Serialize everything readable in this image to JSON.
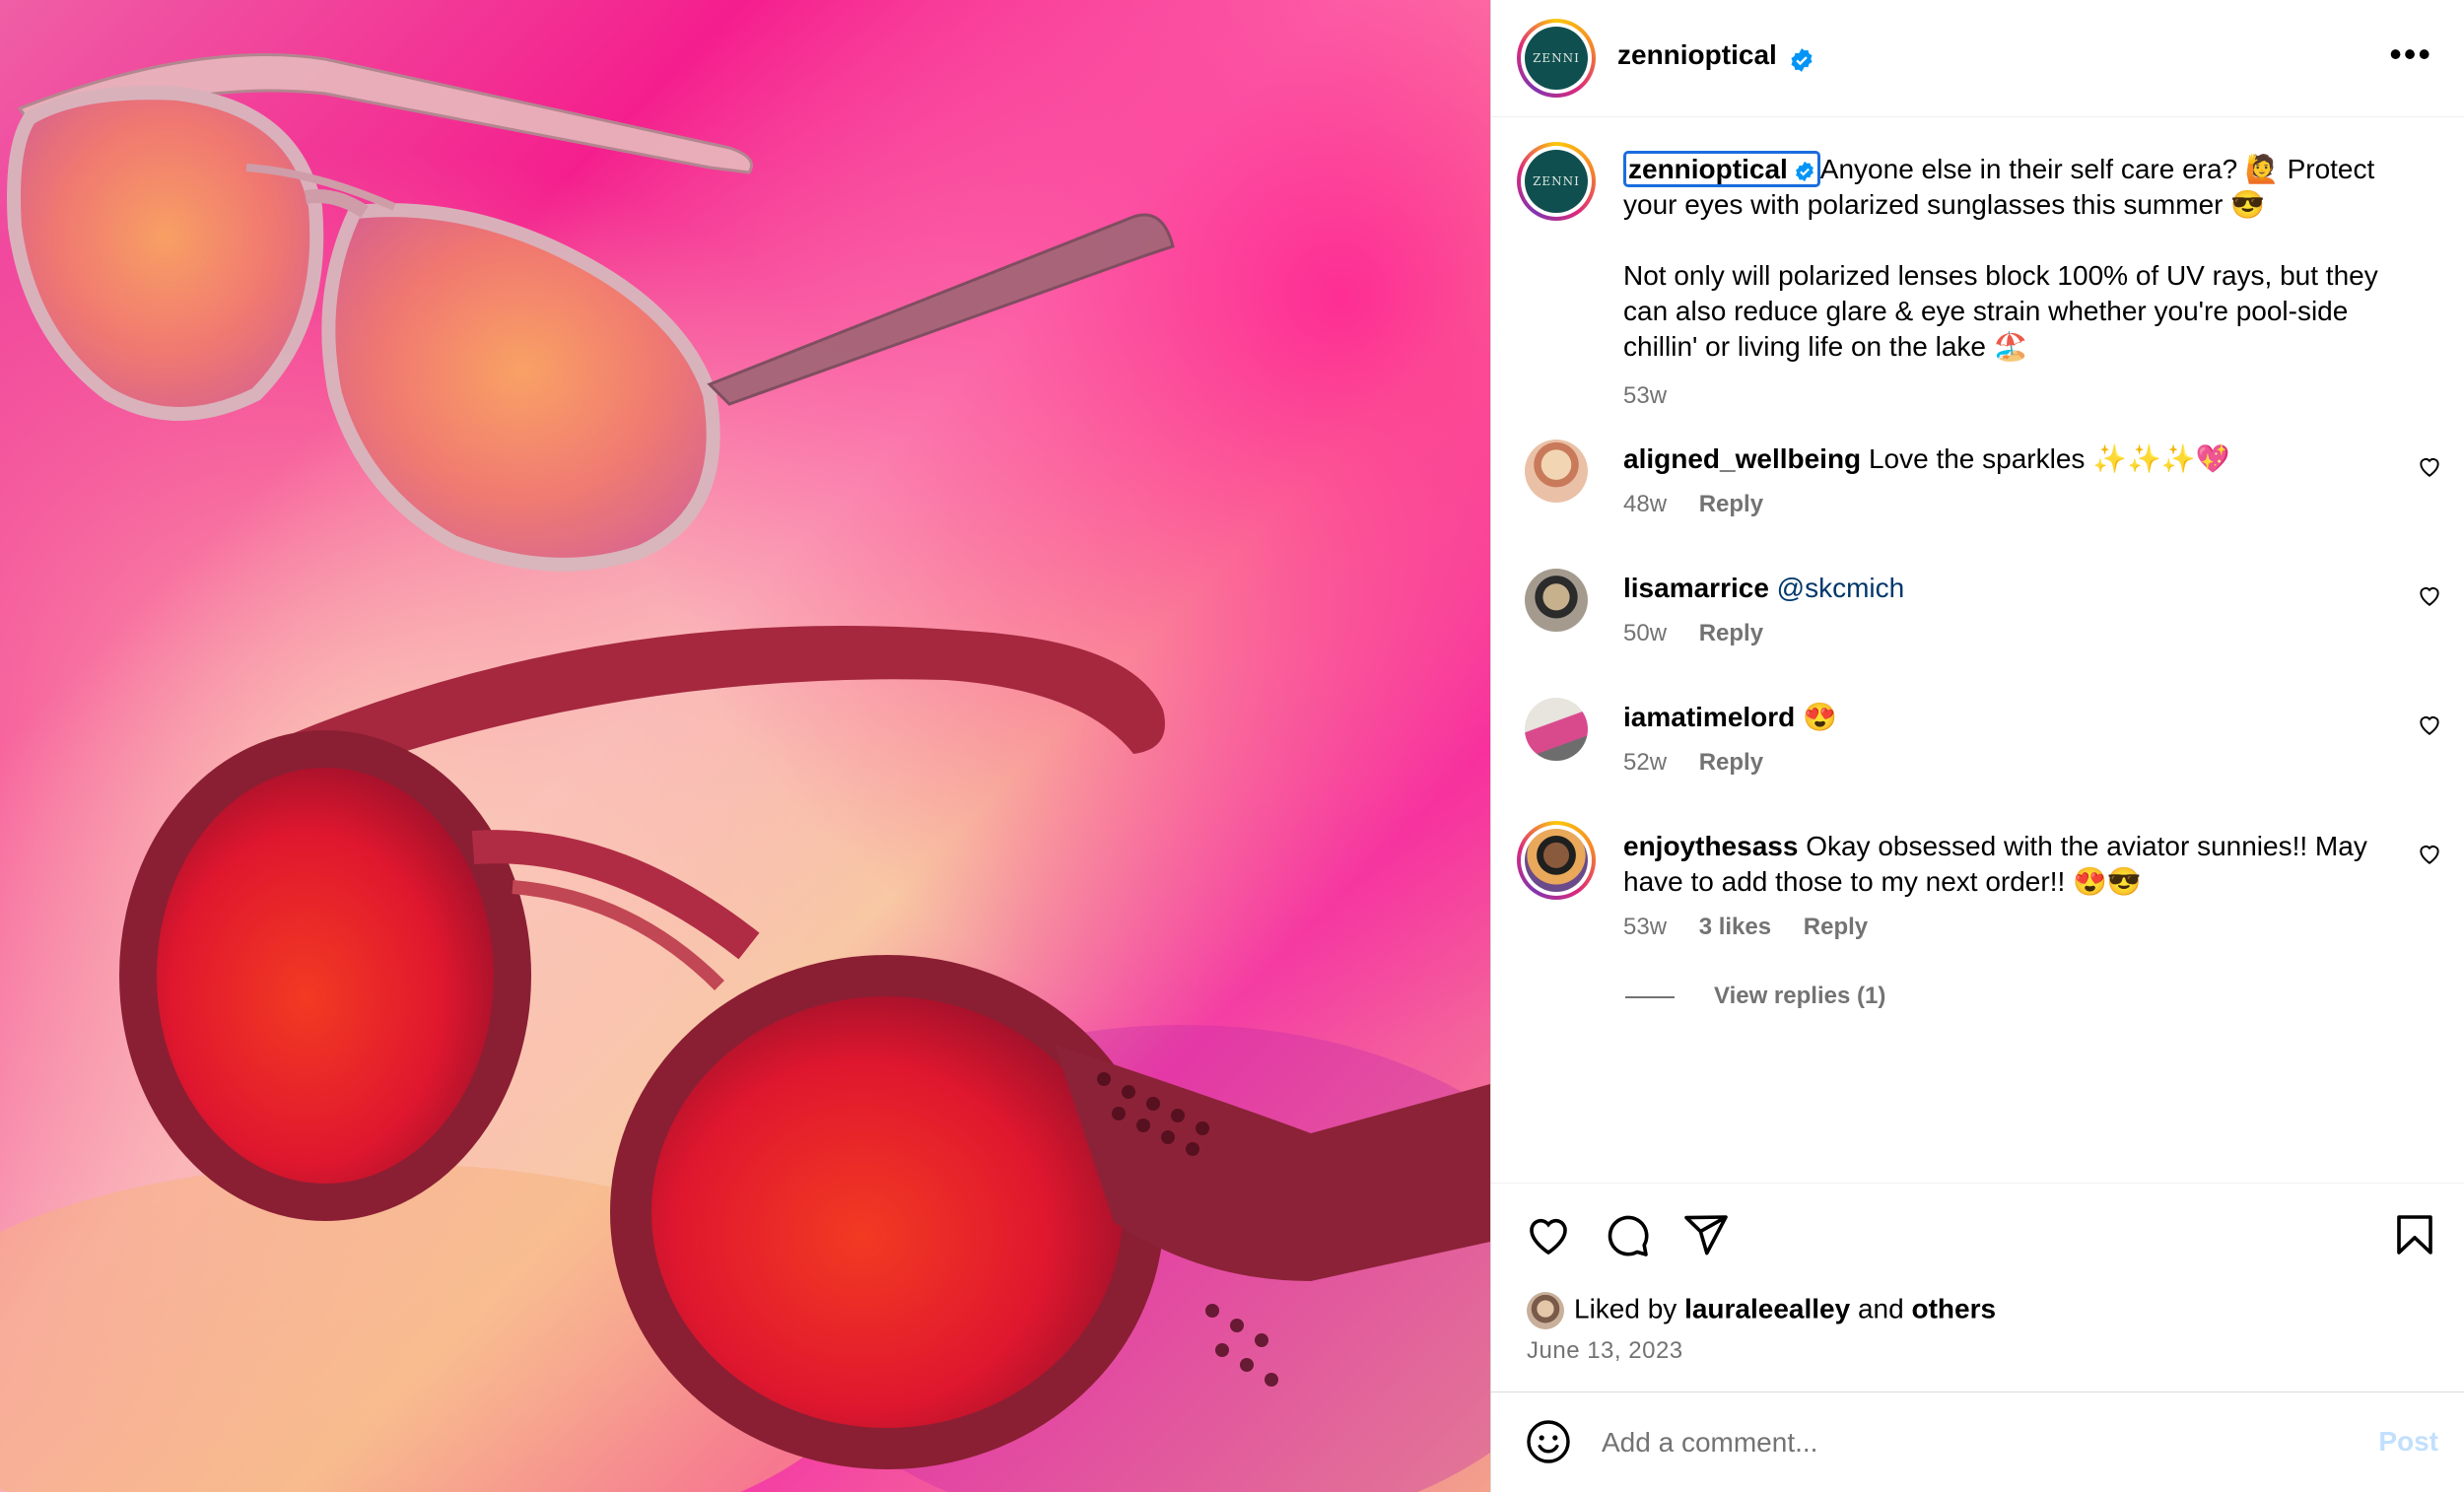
{
  "post": {
    "username": "zennioptical",
    "brand_avatar_text": "ZENNI",
    "more_label": "•••"
  },
  "caption": {
    "username": "zennioptical",
    "text_line1": "Anyone else in their self care era? 🙋 Protect your eyes with polarized sunglasses this summer 😎",
    "text_line2": "Not only will polarized lenses block 100% of UV rays, but they can also reduce glare & eye strain whether you're pool-side chillin' or living life on the lake 🏖️",
    "time": "53w"
  },
  "comments": [
    {
      "username": "aligned_wellbeing",
      "text": "Love the sparkles ✨✨✨💖",
      "time": "48w",
      "reply_label": "Reply"
    },
    {
      "username": "lisamarrice",
      "mention": "@skcmich",
      "time": "50w",
      "reply_label": "Reply"
    },
    {
      "username": "iamatimelord",
      "text": "😍",
      "time": "52w",
      "reply_label": "Reply"
    },
    {
      "username": "enjoythesass",
      "text": "Okay obsessed with the aviator sunnies!! May have to add those to my next order!! 😍😎",
      "time": "53w",
      "likes": "3 likes",
      "reply_label": "Reply"
    }
  ],
  "view_replies": "View replies (1)",
  "likes": {
    "prefix": "Liked by",
    "user": "lauraleealley",
    "and": "and",
    "others": "others"
  },
  "date": "June 13, 2023",
  "composer": {
    "placeholder": "Add a comment...",
    "post_label": "Post"
  },
  "icons": {
    "verified": "verified-badge-icon",
    "more": "more-options-icon",
    "like": "heart-icon",
    "comment": "comment-bubble-icon",
    "share": "paper-plane-icon",
    "save": "bookmark-icon",
    "emoji": "emoji-smiley-icon"
  },
  "colors": {
    "verified_blue": "#0095f6",
    "link_blue": "#00376b",
    "muted": "#737373",
    "post_disabled": "#c2dffd"
  }
}
